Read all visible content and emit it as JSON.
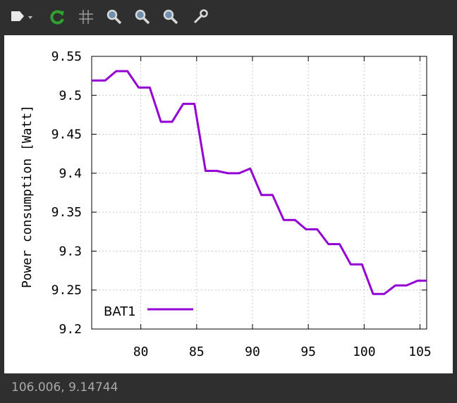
{
  "toolbar": {
    "buttons": [
      {
        "name": "export-icon",
        "color": "#e8e8e8"
      },
      {
        "name": "replot-icon",
        "color": "#2ea12e"
      },
      {
        "name": "grid-icon",
        "color": "#bbbbbb"
      },
      {
        "name": "zoom-in-icon",
        "color": "#cfcfcf"
      },
      {
        "name": "zoom-out-icon",
        "color": "#cfcfcf"
      },
      {
        "name": "zoom-reset-icon",
        "color": "#cfcfcf"
      },
      {
        "name": "settings-wrench-icon",
        "color": "#cfcfcf"
      }
    ]
  },
  "status": {
    "coordinates": "106.006,  9.14744"
  },
  "chart_data": {
    "type": "line",
    "title": "",
    "xlabel": "",
    "ylabel": "Power consumption [Watt]",
    "xlim": [
      75.6,
      105.6
    ],
    "ylim": [
      9.2,
      9.55
    ],
    "xticks": [
      "80",
      "85",
      "90",
      "95",
      "100",
      "105"
    ],
    "yticks": [
      "9.2",
      "9.25",
      "9.3",
      "9.35",
      "9.4",
      "9.45",
      "9.5",
      "9.55"
    ],
    "grid": true,
    "legend": "bottom-left",
    "series": [
      {
        "name": "BAT1",
        "color": "#9400d3",
        "x": [
          75.6,
          76.8,
          77.8,
          78.8,
          79.8,
          80.8,
          81.8,
          82.8,
          83.8,
          84.8,
          85.8,
          86.8,
          87.8,
          88.8,
          89.8,
          90.8,
          91.8,
          92.8,
          93.8,
          94.8,
          95.8,
          96.8,
          97.8,
          98.8,
          99.8,
          100.8,
          101.8,
          102.8,
          103.8,
          104.8,
          105.6
        ],
        "y": [
          9.519,
          9.519,
          9.531,
          9.531,
          9.51,
          9.51,
          9.466,
          9.466,
          9.489,
          9.489,
          9.403,
          9.403,
          9.4,
          9.4,
          9.406,
          9.372,
          9.372,
          9.34,
          9.34,
          9.328,
          9.328,
          9.309,
          9.309,
          9.283,
          9.283,
          9.245,
          9.245,
          9.256,
          9.256,
          9.262,
          9.262
        ]
      }
    ]
  }
}
